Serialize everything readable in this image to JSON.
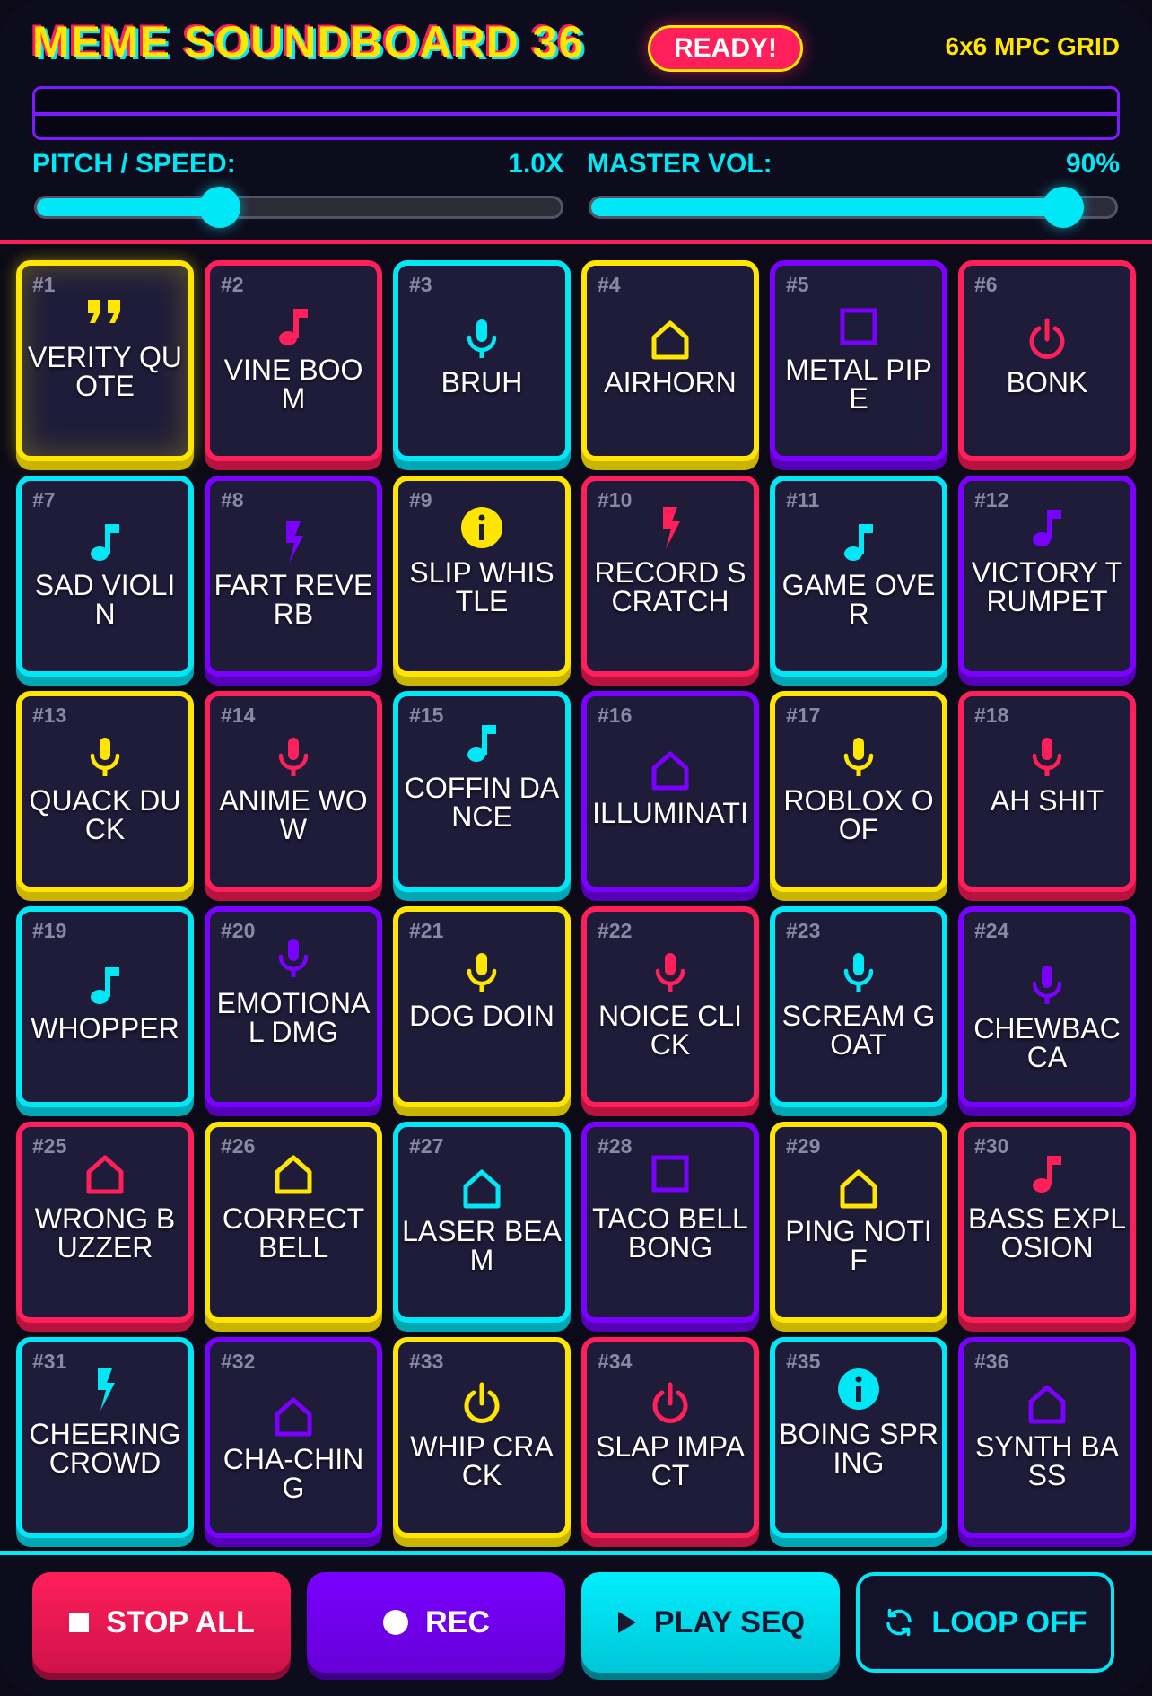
{
  "header": {
    "title": "MEME SOUNDBOARD 36",
    "status_badge": "READY!",
    "grid_label": "6x6 MPC GRID"
  },
  "controls": {
    "pitch": {
      "label": "PITCH / SPEED:",
      "value_text": "1.0X",
      "level": 0.35
    },
    "volume": {
      "label": "MASTER VOL:",
      "value_text": "90%",
      "level": 0.9
    }
  },
  "colors": {
    "yellow": "#ffe600",
    "pink": "#ff1f5a",
    "cyan": "#00e7f6",
    "purple": "#7a00ff"
  },
  "pads": [
    {
      "num": "#1",
      "label": "VERITY QUOTE",
      "color": "yellow",
      "icon": "quote-icon"
    },
    {
      "num": "#2",
      "label": "VINE BOOM",
      "color": "pink",
      "icon": "music-note-icon"
    },
    {
      "num": "#3",
      "label": "BRUH",
      "color": "cyan",
      "icon": "microphone-icon"
    },
    {
      "num": "#4",
      "label": "AIRHORN",
      "color": "yellow",
      "icon": "house-icon"
    },
    {
      "num": "#5",
      "label": "METAL PIPE",
      "color": "purple",
      "icon": "square-icon"
    },
    {
      "num": "#6",
      "label": "BONK",
      "color": "pink",
      "icon": "power-icon"
    },
    {
      "num": "#7",
      "label": "SAD VIOLIN",
      "color": "cyan",
      "icon": "music-note-icon"
    },
    {
      "num": "#8",
      "label": "FART REVERB",
      "color": "purple",
      "icon": "lightning-icon"
    },
    {
      "num": "#9",
      "label": "SLIP WHISTLE",
      "color": "yellow",
      "icon": "info-icon"
    },
    {
      "num": "#10",
      "label": "RECORD SCRATCH",
      "color": "pink",
      "icon": "lightning-icon"
    },
    {
      "num": "#11",
      "label": "GAME OVER",
      "color": "cyan",
      "icon": "music-note-icon"
    },
    {
      "num": "#12",
      "label": "VICTORY TRUMPET",
      "color": "purple",
      "icon": "music-note-icon"
    },
    {
      "num": "#13",
      "label": "QUACK DUCK",
      "color": "yellow",
      "icon": "microphone-icon"
    },
    {
      "num": "#14",
      "label": "ANIME WOW",
      "color": "pink",
      "icon": "microphone-icon"
    },
    {
      "num": "#15",
      "label": "COFFIN DANCE",
      "color": "cyan",
      "icon": "music-note-icon"
    },
    {
      "num": "#16",
      "label": "ILLUMINATI",
      "color": "purple",
      "icon": "house-icon"
    },
    {
      "num": "#17",
      "label": "ROBLOX OOF",
      "color": "yellow",
      "icon": "microphone-icon"
    },
    {
      "num": "#18",
      "label": "AH SHIT",
      "color": "pink",
      "icon": "microphone-icon"
    },
    {
      "num": "#19",
      "label": "WHOPPER",
      "color": "cyan",
      "icon": "music-note-icon"
    },
    {
      "num": "#20",
      "label": "EMOTIONAL DMG",
      "color": "purple",
      "icon": "microphone-icon"
    },
    {
      "num": "#21",
      "label": "DOG DOIN",
      "color": "yellow",
      "icon": "microphone-icon"
    },
    {
      "num": "#22",
      "label": "NOICE CLICK",
      "color": "pink",
      "icon": "microphone-icon"
    },
    {
      "num": "#23",
      "label": "SCREAM GOAT",
      "color": "cyan",
      "icon": "microphone-icon"
    },
    {
      "num": "#24",
      "label": "CHEWBACCA",
      "color": "purple",
      "icon": "microphone-icon"
    },
    {
      "num": "#25",
      "label": "WRONG BUZZER",
      "color": "pink",
      "icon": "house-icon"
    },
    {
      "num": "#26",
      "label": "CORRECT BELL",
      "color": "yellow",
      "icon": "house-icon"
    },
    {
      "num": "#27",
      "label": "LASER BEAM",
      "color": "cyan",
      "icon": "house-icon"
    },
    {
      "num": "#28",
      "label": "TACO BELL BONG",
      "color": "purple",
      "icon": "square-icon"
    },
    {
      "num": "#29",
      "label": "PING NOTIF",
      "color": "yellow",
      "icon": "house-icon"
    },
    {
      "num": "#30",
      "label": "BASS EXPLOSION",
      "color": "pink",
      "icon": "music-note-icon"
    },
    {
      "num": "#31",
      "label": "CHEERING CROWD",
      "color": "cyan",
      "icon": "lightning-icon"
    },
    {
      "num": "#32",
      "label": "CHA-CHING",
      "color": "purple",
      "icon": "house-icon"
    },
    {
      "num": "#33",
      "label": "WHIP CRACK",
      "color": "yellow",
      "icon": "power-icon"
    },
    {
      "num": "#34",
      "label": "SLAP IMPACT",
      "color": "pink",
      "icon": "power-icon"
    },
    {
      "num": "#35",
      "label": "BOING SPRING",
      "color": "cyan",
      "icon": "info-icon"
    },
    {
      "num": "#36",
      "label": "SYNTH BASS",
      "color": "purple",
      "icon": "house-icon"
    }
  ],
  "footer": {
    "stop_label": "STOP ALL",
    "rec_label": "REC",
    "play_label": "PLAY SEQ",
    "loop_label": "LOOP OFF"
  }
}
